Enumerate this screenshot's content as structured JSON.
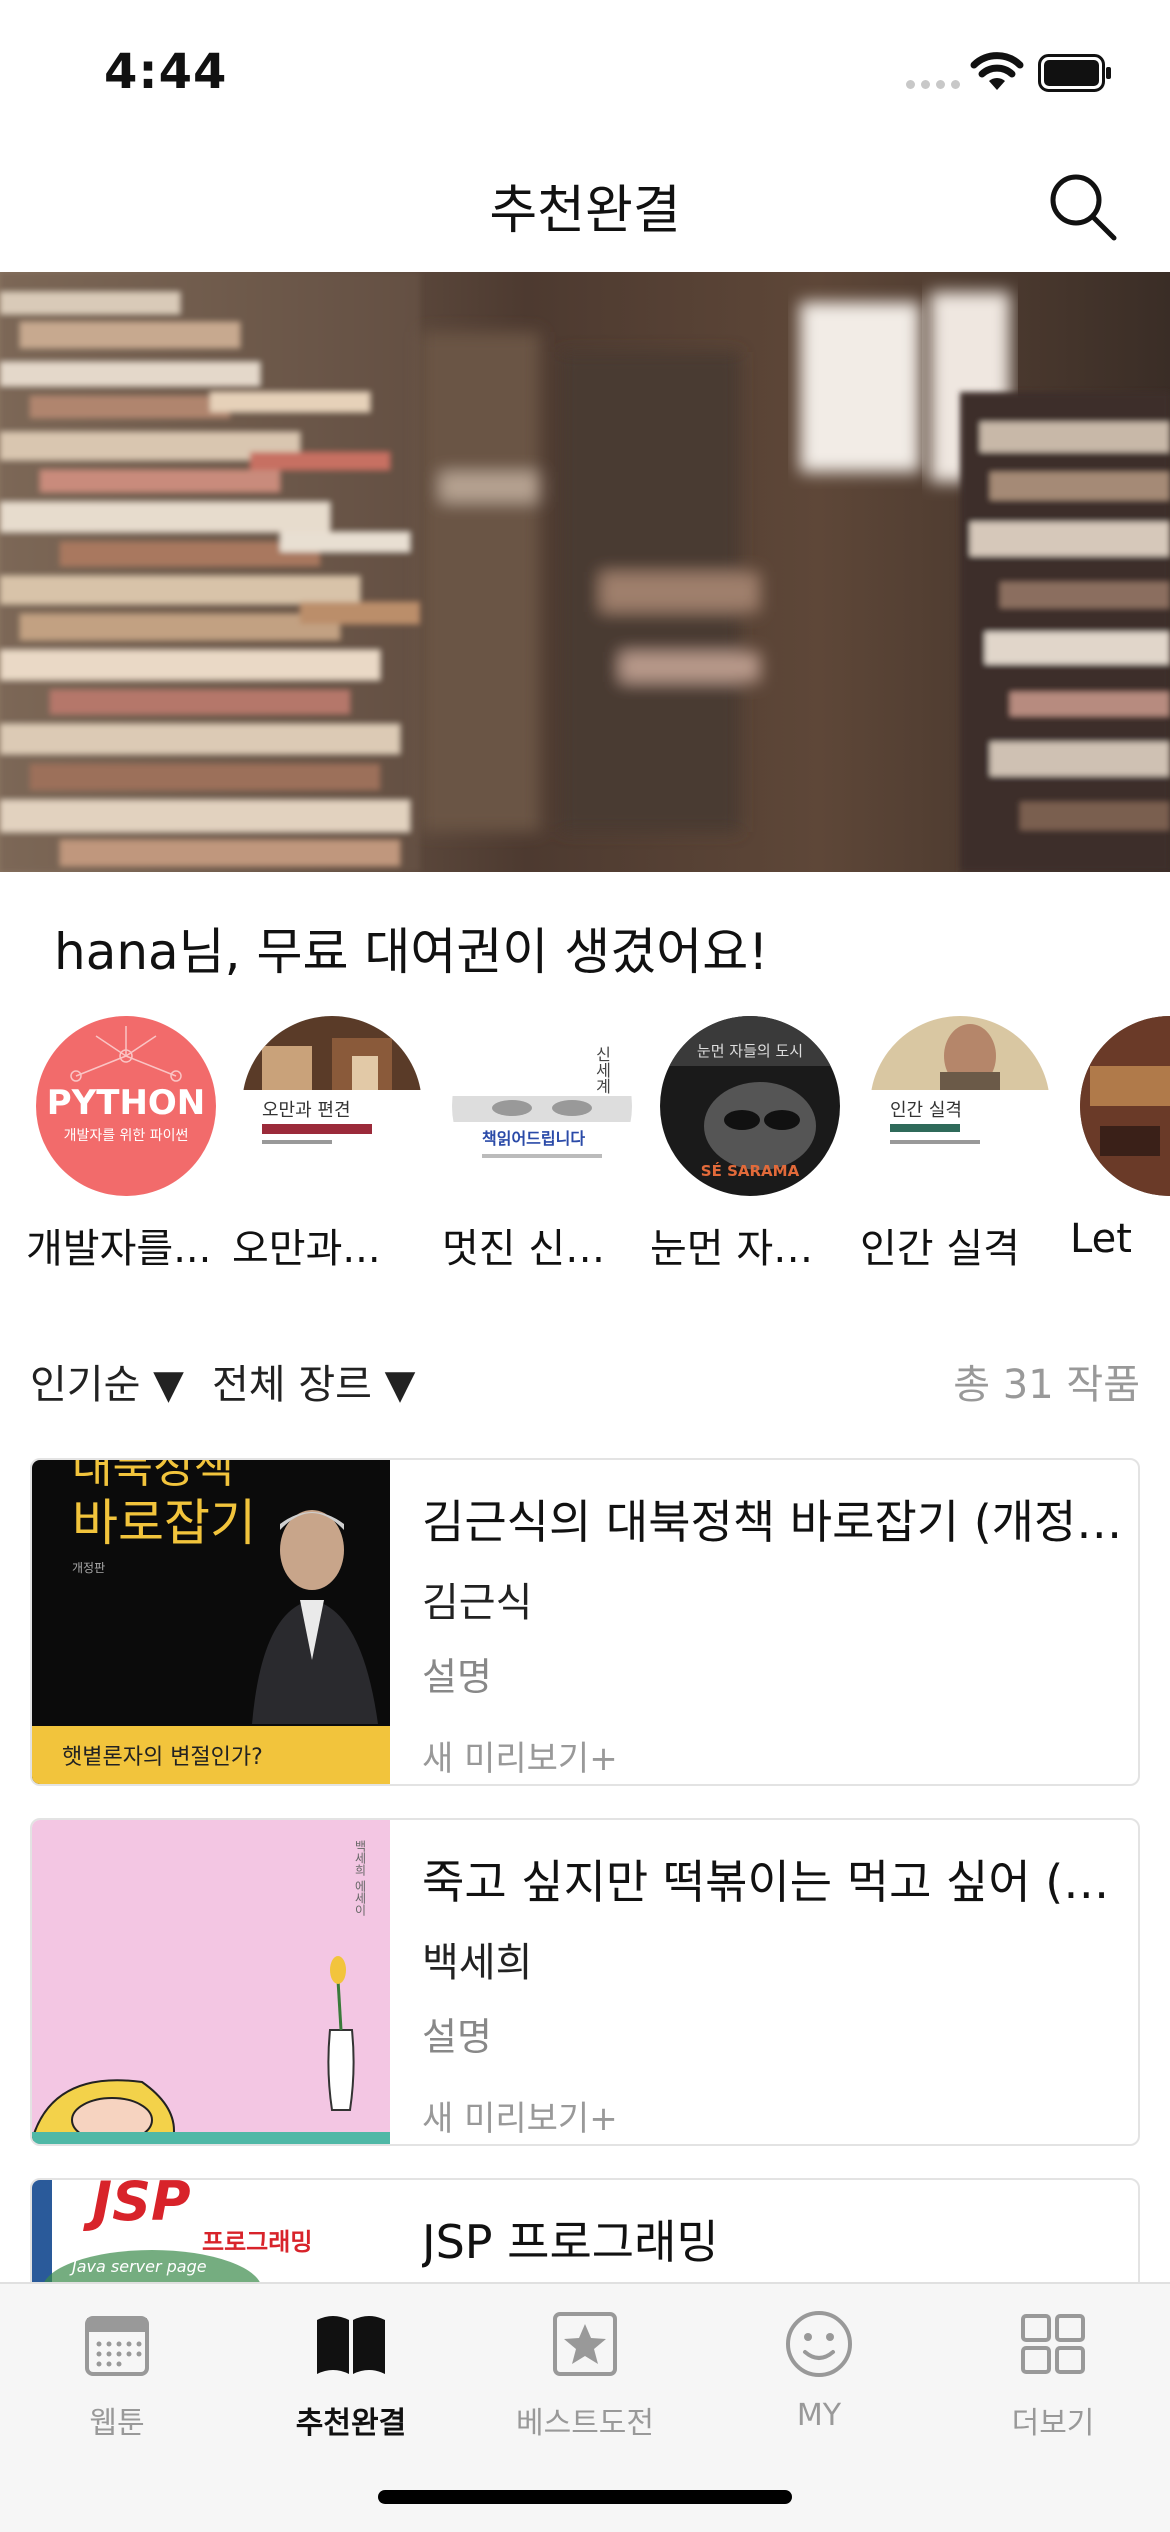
{
  "status_bar": {
    "time": "4:44"
  },
  "nav": {
    "title": "추천완결",
    "search_icon": "search-icon"
  },
  "greeting": "hana님, 무료 대여권이 생겼어요!",
  "carousel": [
    {
      "label": "개발자를...",
      "cover_text": "PYTHON",
      "cover_sub": "개발자를 위한 파이썬"
    },
    {
      "label": "오만과...",
      "cover_text": "오만과 편견"
    },
    {
      "label": "멋진 신…",
      "cover_text": "책읽어드립니다",
      "cover_side": "신세계"
    },
    {
      "label": "눈먼 자…",
      "cover_text": "눈먼 자들의 도시",
      "cover_sub": "SÉ SARAMA"
    },
    {
      "label": "인간 실격",
      "cover_text": "인간 실격"
    },
    {
      "label": "Let"
    }
  ],
  "filters": {
    "sort": "인기순 ▼",
    "genre": "전체 장르 ▼",
    "total": "총 31 작품"
  },
  "books": [
    {
      "title": "김근식의 대북정책 바로잡기 (개정판)",
      "author": "김근식",
      "desc": "설명",
      "preview": "새 미리보기+",
      "cover_line1": "대북정책",
      "cover_line2": "바로잡기",
      "cover_tag": "개정판",
      "cover_footer": "햇볕론자의 변절인가?"
    },
    {
      "title": "죽고 싶지만 떡볶이는 먹고 싶어 (백…",
      "author": "백세희",
      "desc": "설명",
      "preview": "새 미리보기+",
      "cover_side": "백세희 에세이"
    },
    {
      "title": "JSP 프로그래밍",
      "cover_line1": "JSP",
      "cover_line2": "프로그래밍",
      "cover_sub": "Java server page"
    }
  ],
  "tabs": [
    {
      "label": "웹툰",
      "icon": "calendar-icon"
    },
    {
      "label": "추천완결",
      "icon": "open-book-icon"
    },
    {
      "label": "베스트도전",
      "icon": "star-box-icon"
    },
    {
      "label": "MY",
      "icon": "smiley-icon"
    },
    {
      "label": "더보기",
      "icon": "grid-icon"
    }
  ],
  "colors": {
    "accent": "#111111",
    "inactive": "#999999",
    "python_cover": "#f26b6b",
    "pink_cover": "#f3c6e3",
    "yellow_band": "#f2c43c"
  }
}
